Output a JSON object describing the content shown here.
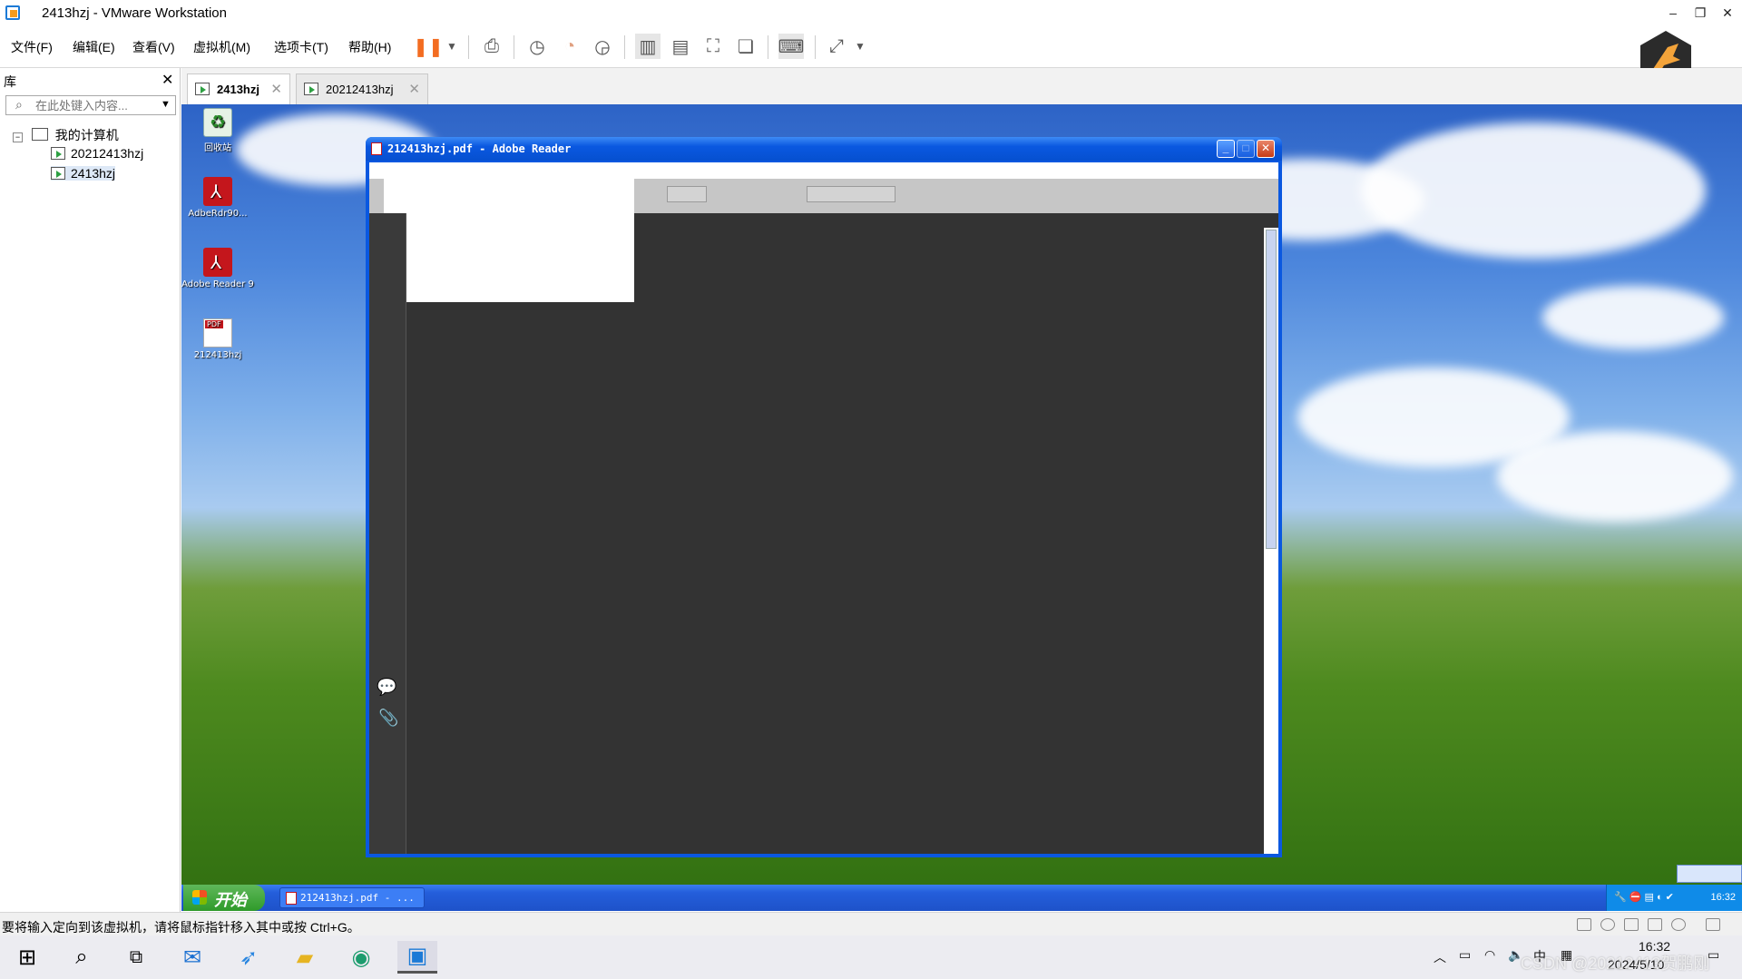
{
  "window": {
    "title": "2413hzj - VMware Workstation",
    "minimize": "–",
    "restore": "❐",
    "close": "✕"
  },
  "menu": [
    "文件(F)",
    "编辑(E)",
    "查看(V)",
    "虚拟机(M)",
    "选项卡(T)",
    "帮助(H)"
  ],
  "library": {
    "title": "库",
    "close": "✕",
    "search_placeholder": "在此处键入内容...",
    "tree": {
      "root": "我的计算机",
      "items": [
        "20212413hzj",
        "2413hzj"
      ],
      "selected": "2413hzj"
    }
  },
  "tabs": [
    {
      "label": "2413hzj",
      "active": true
    },
    {
      "label": "20212413hzj",
      "active": false
    }
  ],
  "guest": {
    "desktop_icons": [
      {
        "label": "回收站",
        "icon": "recycle-bin-icon"
      },
      {
        "label": "AdbeRdr90...",
        "icon": "adobe-installer-icon"
      },
      {
        "label": "Adobe Reader 9",
        "icon": "adobe-reader-icon"
      },
      {
        "label": "212413hzj",
        "icon": "pdf-file-icon"
      }
    ],
    "reader_window": {
      "title": "212413hzj.pdf - Adobe Reader"
    },
    "taskbar": {
      "start": "开始",
      "task_button": "212413hzj.pdf - ...",
      "clock": "16:32"
    }
  },
  "status": {
    "text": "要将输入定向到该虚拟机，请将鼠标指针移入其中或按 Ctrl+G。"
  },
  "host_taskbar": {
    "ime": "中",
    "time": "16:32",
    "date": "2024/5/10",
    "watermark": "CSDN @20212413贺鹏刚"
  },
  "colors": {
    "xp_blue": "#0a58e0",
    "reader_dark": "#333333",
    "vmware_orange": "#f36c21"
  }
}
